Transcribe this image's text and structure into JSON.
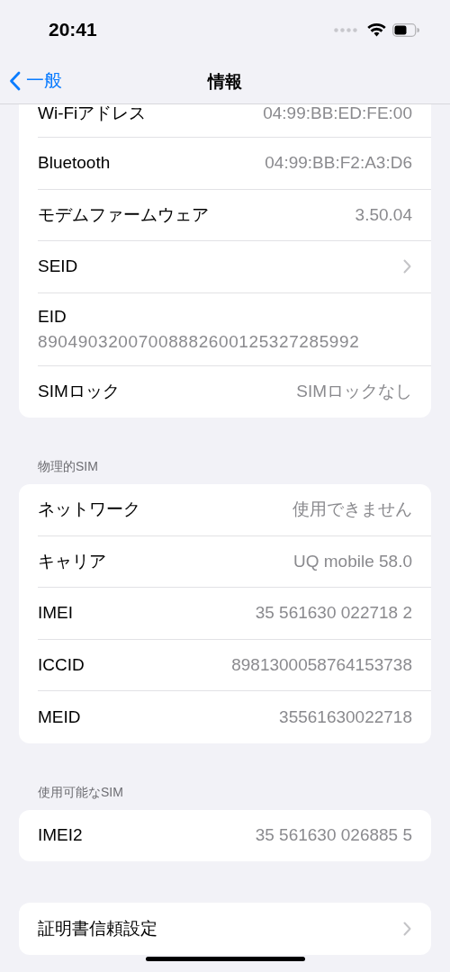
{
  "status_bar": {
    "time": "20:41"
  },
  "nav_bar": {
    "back_label": "一般",
    "title": "情報"
  },
  "groups": [
    {
      "rows": [
        {
          "kind": "value",
          "label": "Wi-Fiアドレス",
          "value": "04:99:BB:ED:FE:00",
          "cut": true
        },
        {
          "kind": "value",
          "label": "Bluetooth",
          "value": "04:99:BB:F2:A3:D6"
        },
        {
          "kind": "value",
          "label": "モデムファームウェア",
          "value": "3.50.04"
        },
        {
          "kind": "chevron",
          "label": "SEID"
        },
        {
          "kind": "stacked",
          "label": "EID",
          "value": "89049032007008882600125327285992"
        },
        {
          "kind": "value",
          "label": "SIMロック",
          "value": "SIMロックなし"
        }
      ]
    },
    {
      "header": "物理的SIM",
      "rows": [
        {
          "kind": "value",
          "label": "ネットワーク",
          "value": "使用できません"
        },
        {
          "kind": "value",
          "label": "キャリア",
          "value": "UQ mobile 58.0"
        },
        {
          "kind": "value",
          "label": "IMEI",
          "value": "35 561630 022718 2"
        },
        {
          "kind": "value",
          "label": "ICCID",
          "value": "8981300058764153738"
        },
        {
          "kind": "value",
          "label": "MEID",
          "value": "35561630022718"
        }
      ]
    },
    {
      "header": "使用可能なSIM",
      "rows": [
        {
          "kind": "value",
          "label": "IMEI2",
          "value": "35 561630 026885 5"
        }
      ]
    },
    {
      "rows": [
        {
          "kind": "chevron",
          "label": "証明書信頼設定"
        }
      ]
    }
  ]
}
